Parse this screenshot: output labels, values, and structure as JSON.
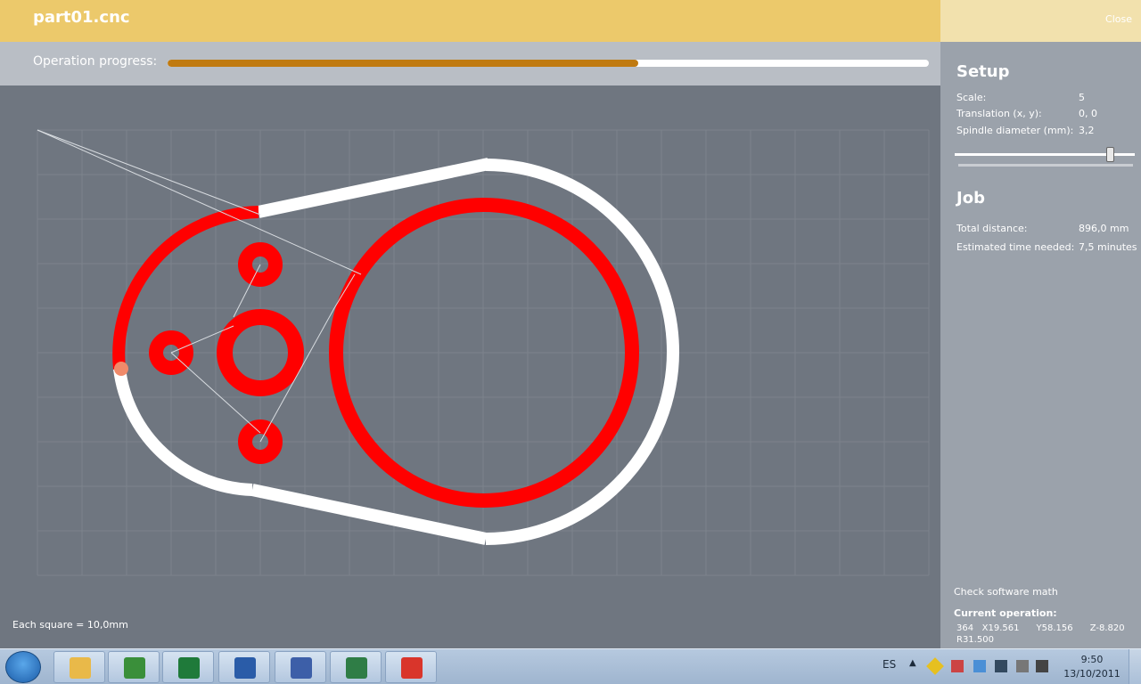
{
  "header": {
    "title": "part01.cnc",
    "close_label": "Close"
  },
  "progress": {
    "label": "Operation progress:",
    "fraction": 0.618,
    "fill_color": "#c07a10"
  },
  "canvas": {
    "scale_note": "Each square = 10,0mm",
    "cut_color": "#ff0000",
    "pending_color": "#ffffff",
    "travel_color": "#d8dce0"
  },
  "setup": {
    "title": "Setup",
    "scale_label": "Scale:",
    "scale_value": "5",
    "translation_label": "Translation (x, y):",
    "translation_value": "0, 0",
    "spindle_label": "Spindle diameter (mm):",
    "spindle_value": "3,2",
    "spindle_slider_level": 0.86
  },
  "job": {
    "title": "Job",
    "distance_label": "Total distance:",
    "distance_value": "896,0 mm",
    "time_label": "Estimated time needed:",
    "time_value": "7,5 minutes"
  },
  "footer": {
    "check_math": "Check software math",
    "current_op_title": "Current operation:",
    "current_op_line1": "364   X19.561      Y58.156      Z-8.820",
    "current_op_line2": "R31.500"
  },
  "taskbar": {
    "apps": [
      {
        "name": "explorer-icon",
        "color": "#e9b949"
      },
      {
        "name": "chrome-icon",
        "color": "#3a8f3a"
      },
      {
        "name": "excel-icon",
        "color": "#1f7a3a"
      },
      {
        "name": "word-icon",
        "color": "#2a5ca8"
      },
      {
        "name": "network-tool-icon",
        "color": "#3d5fa8"
      },
      {
        "name": "csharp-icon",
        "color": "#2f7d46"
      },
      {
        "name": "cnc-app-icon",
        "color": "#d9352b"
      }
    ],
    "language": "ES",
    "time": "9:50",
    "date": "13/10/2011"
  }
}
